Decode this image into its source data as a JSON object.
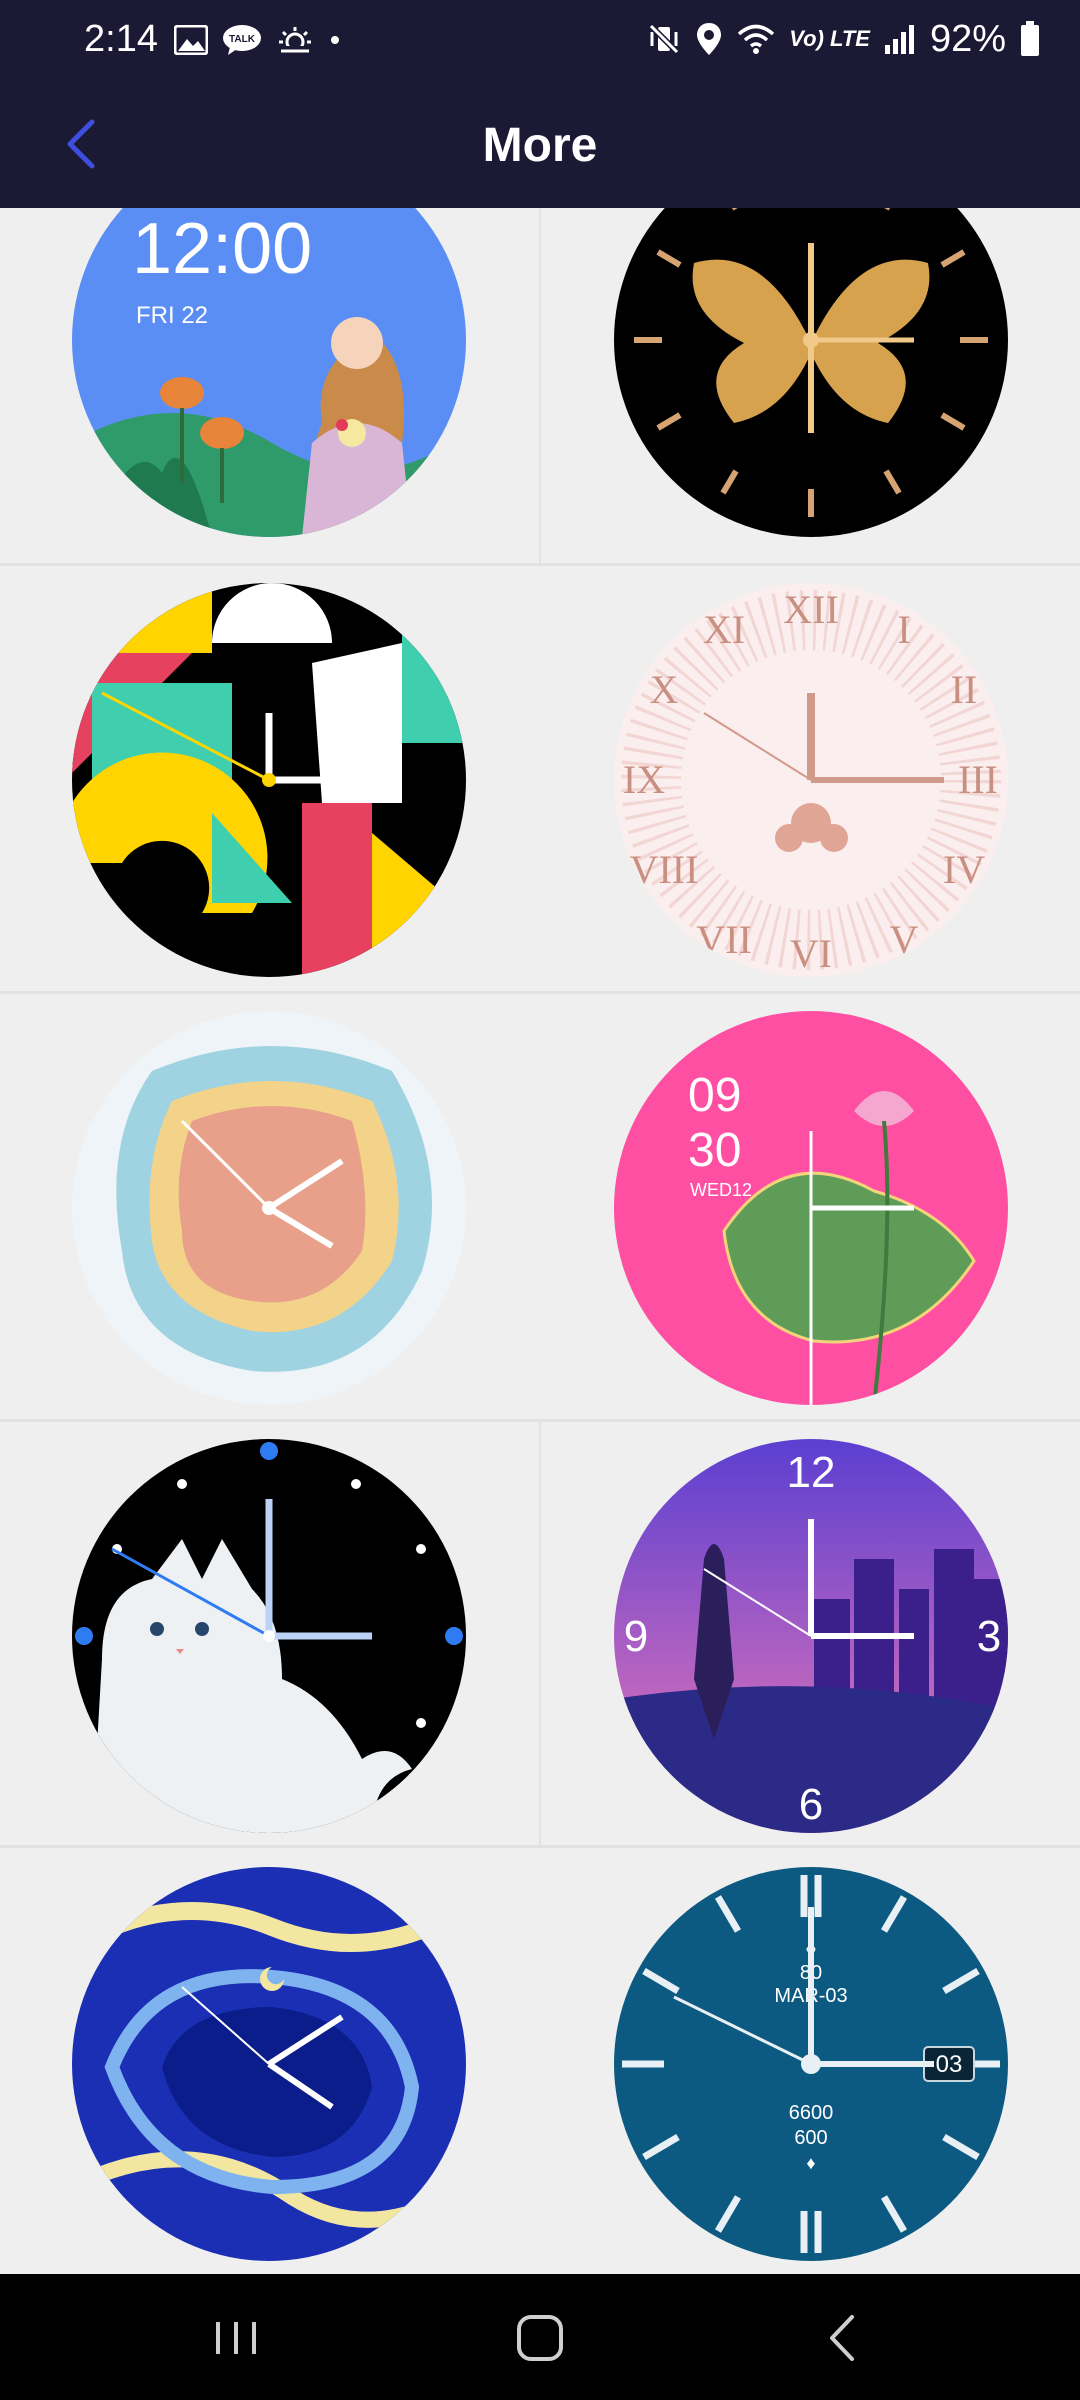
{
  "status_bar": {
    "time": "2:14",
    "network": "Vo) LTE",
    "battery": "92%"
  },
  "header": {
    "title": "More"
  },
  "faces": [
    {
      "name": "Girl with flowers",
      "time": "12:00",
      "date": "FRI 22"
    },
    {
      "name": "Golden butterfly"
    },
    {
      "name": "Geometric shapes"
    },
    {
      "name": "Pink roman"
    },
    {
      "name": "Paper cut layers"
    },
    {
      "name": "Pink lotus",
      "hour": "09",
      "minute": "30",
      "date": "WED12"
    },
    {
      "name": "White cat"
    },
    {
      "name": "City couple",
      "n12": "12",
      "n9": "9",
      "n3": "3",
      "n6": "6"
    },
    {
      "name": "Starry swirl"
    },
    {
      "name": "Blue sport",
      "heart": "80",
      "date": "MAR-03",
      "day": "03",
      "steps": "6600",
      "calories": "600"
    }
  ],
  "colors": {
    "header_bg": "#1b1934",
    "accent": "#3e4fe0",
    "grid_bg": "#efefef"
  }
}
